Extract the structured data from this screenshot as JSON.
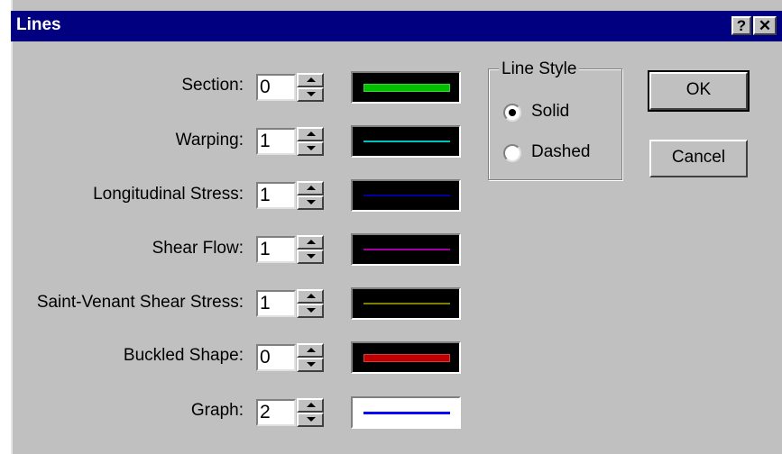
{
  "window": {
    "title": "Lines",
    "help_label": "?",
    "close_label": "✕"
  },
  "rows": [
    {
      "label": "Section:",
      "value": "0",
      "color": "#00c000",
      "style": "thick"
    },
    {
      "label": "Warping:",
      "value": "1",
      "color": "#00c0c0",
      "style": "thin"
    },
    {
      "label": "Longitudinal Stress:",
      "value": "1",
      "color": "#0000a0",
      "style": "thin"
    },
    {
      "label": "Shear Flow:",
      "value": "1",
      "color": "#a000a0",
      "style": "thin"
    },
    {
      "label": "Saint-Venant Shear Stress:",
      "value": "1",
      "color": "#808000",
      "style": "thin"
    },
    {
      "label": "Buckled Shape:",
      "value": "0",
      "color": "#c00000",
      "style": "thick"
    },
    {
      "label": "Graph:",
      "value": "2",
      "color": "#0000ff",
      "style": "medium",
      "background": "#ffffff"
    }
  ],
  "line_style": {
    "title": "Line Style",
    "options": [
      {
        "label": "Solid",
        "selected": true
      },
      {
        "label": "Dashed",
        "selected": false
      }
    ]
  },
  "buttons": {
    "ok": "OK",
    "cancel": "Cancel"
  }
}
